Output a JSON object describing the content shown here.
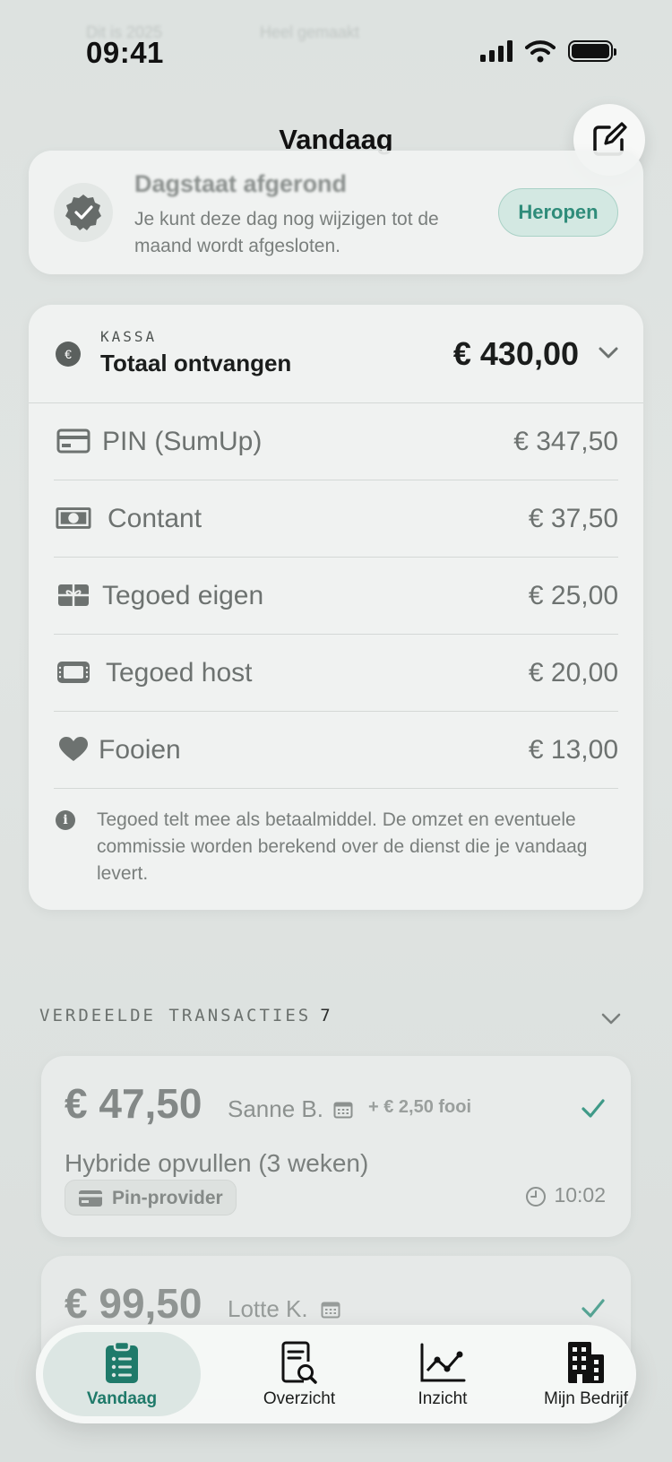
{
  "status_bar": {
    "time": "09:41",
    "ghost_left": "Dit is 2025",
    "ghost_right": "Heel gemaakt",
    "icons": [
      "signal-icon",
      "wifi-icon",
      "battery-icon"
    ]
  },
  "header": {
    "title": "Vandaag",
    "compose_icon": "compose-icon"
  },
  "day_status": {
    "title": "Dagstaat afgerond",
    "subtitle": "Je kunt deze dag nog wijzigen tot de maand wordt afgesloten.",
    "reopen_label": "Heropen"
  },
  "cash": {
    "kicker": "KASSA",
    "label": "Totaal ontvangen",
    "euro_symbol": "€",
    "total": "€ 430,00",
    "rows": [
      {
        "label": "PIN (SumUp)",
        "amount": "€ 347,50",
        "icon": "card-icon"
      },
      {
        "label": "Contant",
        "amount": "€ 37,50",
        "icon": "banknote-icon"
      },
      {
        "label": "Tegoed eigen",
        "amount": "€ 25,00",
        "icon": "gift-card-icon"
      },
      {
        "label": "Tegoed host",
        "amount": "€ 20,00",
        "icon": "voucher-icon"
      },
      {
        "label": "Fooien",
        "amount": "€ 13,00",
        "icon": "heart-icon"
      }
    ],
    "note_icon_glyph": "i",
    "note": "Tegoed telt mee als betaalmiddel. De omzet en eventuele commissie worden berekend over de dienst die je vandaag levert."
  },
  "transactions": {
    "heading": "VERDEELDE TRANSACTIES",
    "count": "7",
    "items": [
      {
        "amount": "€ 47,50",
        "customer": "Sanne B.",
        "tip": "+ € 2,50 fooi",
        "description": "Hybride opvullen (3 weken)",
        "method": "Pin-provider",
        "time": "10:02"
      },
      {
        "amount": "€ 99,50",
        "customer": "Lotte K."
      }
    ]
  },
  "tabbar": {
    "tabs": [
      {
        "label": "Vandaag",
        "icon": "clipboard-list-icon",
        "active": true
      },
      {
        "label": "Overzicht",
        "icon": "document-search-icon",
        "active": false
      },
      {
        "label": "Inzicht",
        "icon": "line-chart-icon",
        "active": false
      },
      {
        "label": "Mijn Bedrijf",
        "icon": "building-icon",
        "active": false
      }
    ]
  },
  "colors": {
    "accent": "#2f8c7a",
    "accent_soft": "#d3e8e2",
    "active_tab": "#1f7a6a",
    "background": "#dfe3e1"
  }
}
